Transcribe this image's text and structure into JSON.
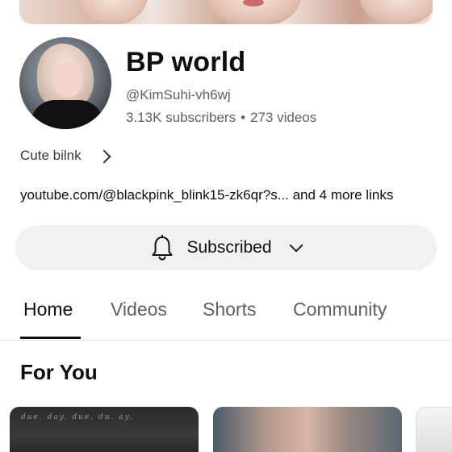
{
  "channel": {
    "name": "BP world",
    "handle": "@KimSuhi-vh6wj",
    "subscribers": "3.13K subscribers",
    "separator": "•",
    "videos": "273 videos",
    "about": "Cute bilnk",
    "links": "youtube.com/@blackpink_blink15-zk6qr?s... and 4 more links"
  },
  "subscribe_button": {
    "label": "Subscribed",
    "icon": "bell-icon"
  },
  "tabs": [
    {
      "label": "Home",
      "active": true
    },
    {
      "label": "Videos",
      "active": false
    },
    {
      "label": "Shorts",
      "active": false
    },
    {
      "label": "Community",
      "active": false
    }
  ],
  "section": {
    "title": "For You"
  },
  "thumbnails": {
    "first_caption": "due. day. due.   du. ay."
  }
}
